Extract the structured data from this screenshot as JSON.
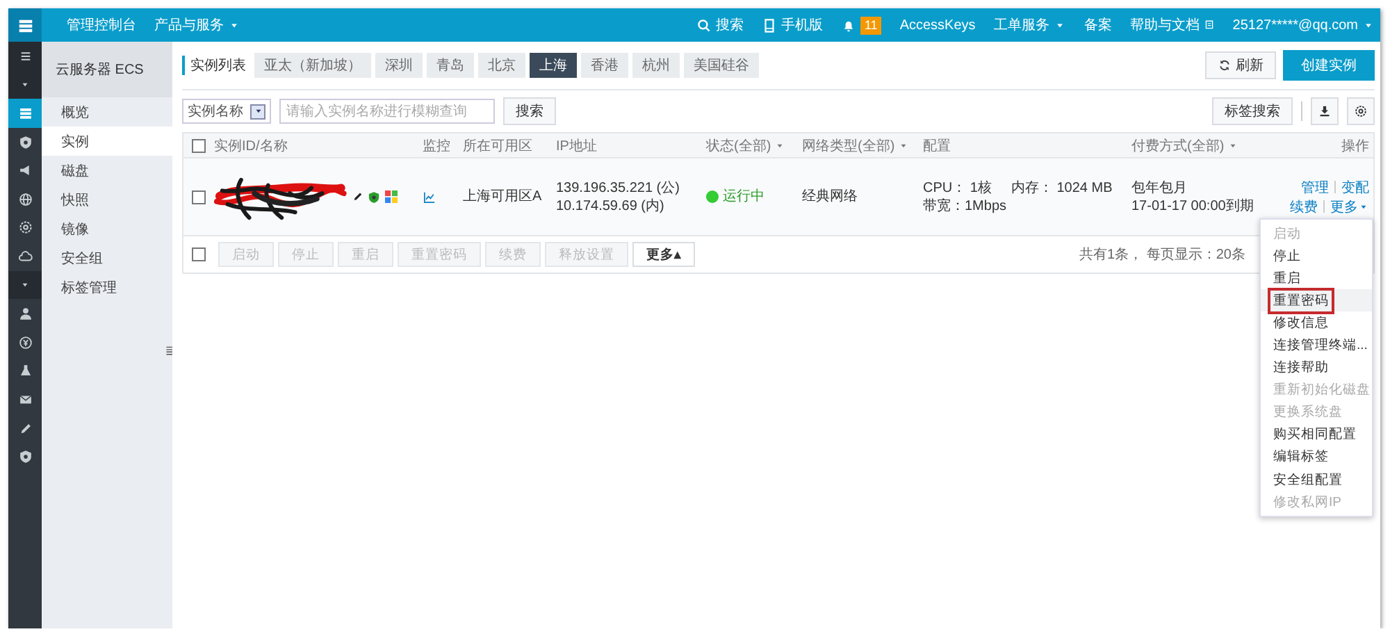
{
  "top_bar": {
    "console": "管理控制台",
    "products": {
      "label": "产品与服务",
      "caret": true
    },
    "right": [
      {
        "kind": "search",
        "label": "搜索"
      },
      {
        "kind": "mobile",
        "label": "手机版"
      },
      {
        "kind": "bell",
        "badge": "11"
      },
      {
        "kind": "text",
        "label": "AccessKeys"
      },
      {
        "kind": "menu",
        "label": "工单服务"
      },
      {
        "kind": "text",
        "label": "备案"
      },
      {
        "kind": "docs",
        "label": "帮助与文档"
      },
      {
        "kind": "menu",
        "label": "25127*****@qq.com"
      }
    ]
  },
  "icon_rail": [
    {
      "kind": "menu",
      "selected": false
    },
    {
      "kind": "caret",
      "selected": false
    },
    {
      "kind": "server",
      "selected": true
    },
    {
      "kind": "shield",
      "selected": false
    },
    {
      "kind": "speaker",
      "selected": false
    },
    {
      "kind": "globe",
      "selected": false
    },
    {
      "kind": "settings",
      "selected": false
    },
    {
      "kind": "cloud",
      "selected": false
    },
    {
      "kind": "caret",
      "selected": false
    },
    {
      "kind": "user",
      "selected": false
    },
    {
      "kind": "yen",
      "selected": false
    },
    {
      "kind": "flask",
      "selected": false
    },
    {
      "kind": "mail",
      "selected": false
    },
    {
      "kind": "pencil",
      "selected": false
    },
    {
      "kind": "shield",
      "selected": false
    }
  ],
  "sidebar": {
    "title": "云服务器 ECS",
    "items": [
      {
        "label": "概览",
        "selected": false
      },
      {
        "label": "实例",
        "selected": true
      },
      {
        "label": "磁盘",
        "selected": false
      },
      {
        "label": "快照",
        "selected": false
      },
      {
        "label": "镜像",
        "selected": false
      },
      {
        "label": "安全组",
        "selected": false
      },
      {
        "label": "标签管理",
        "selected": false
      }
    ]
  },
  "region_tabs": {
    "label": "实例列表",
    "tabs": [
      {
        "label": "亚太（新加坡）",
        "selected": false
      },
      {
        "label": "深圳",
        "selected": false
      },
      {
        "label": "青岛",
        "selected": false
      },
      {
        "label": "北京",
        "selected": false
      },
      {
        "label": "上海",
        "selected": true
      },
      {
        "label": "香港",
        "selected": false
      },
      {
        "label": "杭州",
        "selected": false
      },
      {
        "label": "美国硅谷",
        "selected": false
      }
    ]
  },
  "header_buttons": [
    {
      "kind": "refresh",
      "label": "刷新"
    },
    {
      "kind": "primary",
      "label": "创建实例"
    }
  ],
  "filter": {
    "field": "实例名称",
    "placeholder": "请输入实例名称进行模糊查询",
    "search": "搜索",
    "tag_search": "标签搜索"
  },
  "table": {
    "header_checked": false,
    "columns": [
      {
        "label": "实例ID/名称",
        "caret": false
      },
      {
        "label": "监控",
        "caret": false
      },
      {
        "label": "所在可用区",
        "caret": false
      },
      {
        "label": "IP地址",
        "caret": false
      },
      {
        "label": "状态(全部)",
        "caret": true
      },
      {
        "label": "网络类型(全部)",
        "caret": true
      },
      {
        "label": "配置",
        "caret": false
      },
      {
        "label": "付费方式(全部)",
        "caret": true
      },
      {
        "label": "操作",
        "caret": false
      }
    ],
    "rows": [
      {
        "checked": false,
        "zone": "上海可用区A",
        "ip": [
          "139.196.35.221 (公)",
          "10.174.59.69 (内)"
        ],
        "status": "运行中",
        "network": "经典网络",
        "config": [
          [
            "CPU： 1核",
            "内存： 1024 MB"
          ],
          [
            "带宽：1Mbps"
          ]
        ],
        "billing": [
          "包年包月",
          "17-01-17 00:00到期"
        ],
        "actions": [
          [
            {
              "label": "管理",
              "caret": false
            },
            {
              "label": "变配",
              "caret": false
            }
          ],
          [
            {
              "label": "续费",
              "caret": false
            },
            {
              "label": "更多",
              "caret": true
            }
          ]
        ]
      }
    ]
  },
  "bulk": {
    "checked": false,
    "buttons": [
      {
        "label": "启动",
        "disabled": true
      },
      {
        "label": "停止",
        "disabled": true
      },
      {
        "label": "重启",
        "disabled": true
      },
      {
        "label": "重置密码",
        "disabled": true
      },
      {
        "label": "续费",
        "disabled": true
      },
      {
        "label": "释放设置",
        "disabled": true
      },
      {
        "label": "更多▴",
        "disabled": false
      }
    ],
    "summary": "共有1条， 每页显示：20条"
  },
  "more_menu": [
    {
      "label": "启动",
      "disabled": true,
      "highlighted": false
    },
    {
      "label": "停止",
      "disabled": false,
      "highlighted": false
    },
    {
      "label": "重启",
      "disabled": false,
      "highlighted": false
    },
    {
      "label": "重置密码",
      "disabled": false,
      "highlighted": true
    },
    {
      "label": "修改信息",
      "disabled": false,
      "highlighted": false
    },
    {
      "label": "连接管理终端...",
      "disabled": false,
      "highlighted": false
    },
    {
      "label": "连接帮助",
      "disabled": false,
      "highlighted": false
    },
    {
      "label": "重新初始化磁盘",
      "disabled": true,
      "highlighted": false
    },
    {
      "label": "更换系统盘",
      "disabled": true,
      "highlighted": false
    },
    {
      "label": "购买相同配置",
      "disabled": false,
      "highlighted": false
    },
    {
      "label": "编辑标签",
      "disabled": false,
      "highlighted": false
    },
    {
      "label": "安全组配置",
      "disabled": false,
      "highlighted": false
    },
    {
      "label": "修改私网IP",
      "disabled": true,
      "highlighted": false
    }
  ]
}
